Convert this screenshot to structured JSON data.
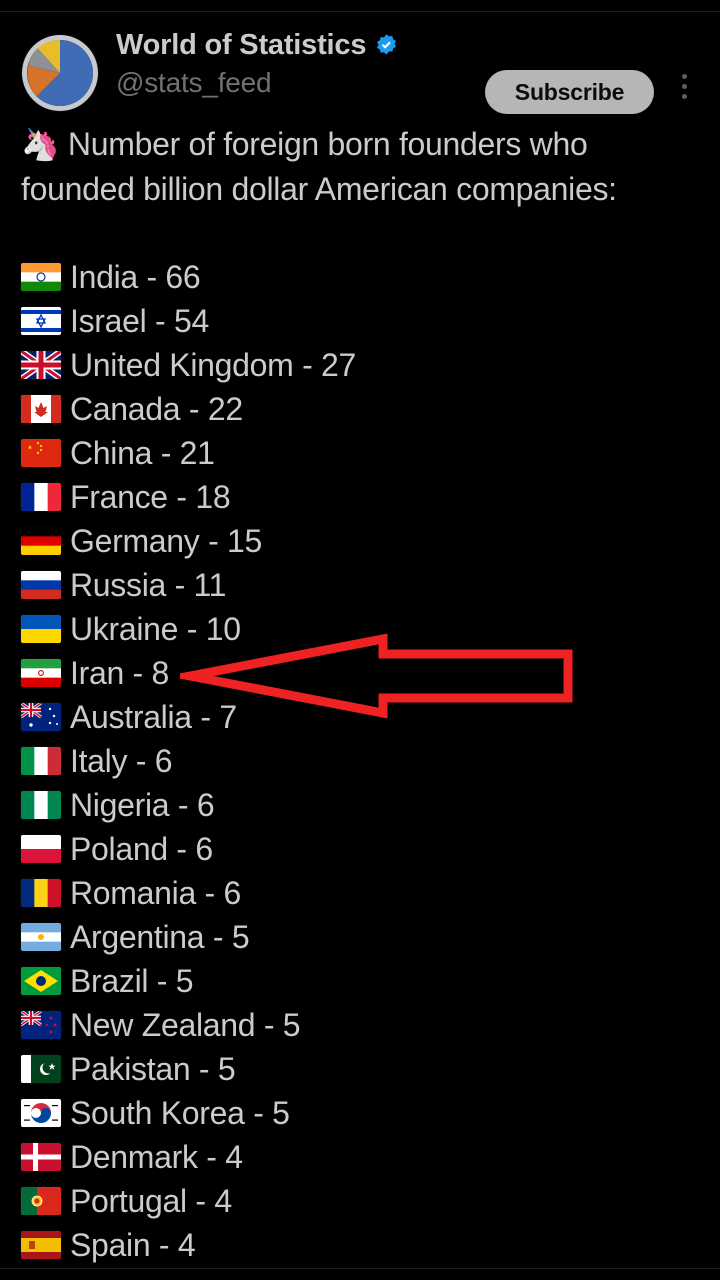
{
  "colors": {
    "background": "#000000",
    "text": "#c9cbcd",
    "muted_text": "#6e7276",
    "verified_blue": "#1d9bf0",
    "subscribe_bg": "#b5b6b8",
    "annotation_red": "#ee2222"
  },
  "header": {
    "display_name": "World of Statistics",
    "handle": "@stats_feed",
    "verified": true,
    "subscribe_label": "Subscribe",
    "more_icon": "more-vertical-icon",
    "avatar_icon": "pie-chart-avatar"
  },
  "post": {
    "intro_emoji": "🦄",
    "intro_text": "Number of foreign born founders who founded billion dollar American companies:"
  },
  "annotation": {
    "type": "arrow",
    "direction": "left",
    "color": "#ee2222",
    "points_at": "Iran - 8"
  },
  "list": {
    "separator": " - ",
    "items": [
      {
        "country": "India",
        "value": 66,
        "flag": "in",
        "label": "India - 66"
      },
      {
        "country": "Israel",
        "value": 54,
        "flag": "il",
        "label": "Israel - 54"
      },
      {
        "country": "United Kingdom",
        "value": 27,
        "flag": "gb",
        "label": "United Kingdom - 27"
      },
      {
        "country": "Canada",
        "value": 22,
        "flag": "ca",
        "label": "Canada - 22"
      },
      {
        "country": "China",
        "value": 21,
        "flag": "cn",
        "label": "China - 21"
      },
      {
        "country": "France",
        "value": 18,
        "flag": "fr",
        "label": "France - 18"
      },
      {
        "country": "Germany",
        "value": 15,
        "flag": "de",
        "label": "Germany - 15"
      },
      {
        "country": "Russia",
        "value": 11,
        "flag": "ru",
        "label": "Russia - 11"
      },
      {
        "country": "Ukraine",
        "value": 10,
        "flag": "ua",
        "label": "Ukraine - 10"
      },
      {
        "country": "Iran",
        "value": 8,
        "flag": "ir",
        "label": "Iran - 8"
      },
      {
        "country": "Australia",
        "value": 7,
        "flag": "au",
        "label": "Australia - 7"
      },
      {
        "country": "Italy",
        "value": 6,
        "flag": "it",
        "label": "Italy - 6"
      },
      {
        "country": "Nigeria",
        "value": 6,
        "flag": "ng",
        "label": "Nigeria - 6"
      },
      {
        "country": "Poland",
        "value": 6,
        "flag": "pl",
        "label": "Poland - 6"
      },
      {
        "country": "Romania",
        "value": 6,
        "flag": "ro",
        "label": "Romania - 6"
      },
      {
        "country": "Argentina",
        "value": 5,
        "flag": "ar",
        "label": "Argentina - 5"
      },
      {
        "country": "Brazil",
        "value": 5,
        "flag": "br",
        "label": "Brazil - 5"
      },
      {
        "country": "New Zealand",
        "value": 5,
        "flag": "nz",
        "label": "New Zealand - 5"
      },
      {
        "country": "Pakistan",
        "value": 5,
        "flag": "pk",
        "label": "Pakistan - 5"
      },
      {
        "country": "South Korea",
        "value": 5,
        "flag": "kr",
        "label": "South Korea - 5"
      },
      {
        "country": "Denmark",
        "value": 4,
        "flag": "dk",
        "label": "Denmark - 4"
      },
      {
        "country": "Portugal",
        "value": 4,
        "flag": "pt",
        "label": "Portugal - 4"
      },
      {
        "country": "Spain",
        "value": 4,
        "flag": "es",
        "label": "Spain - 4"
      }
    ]
  }
}
